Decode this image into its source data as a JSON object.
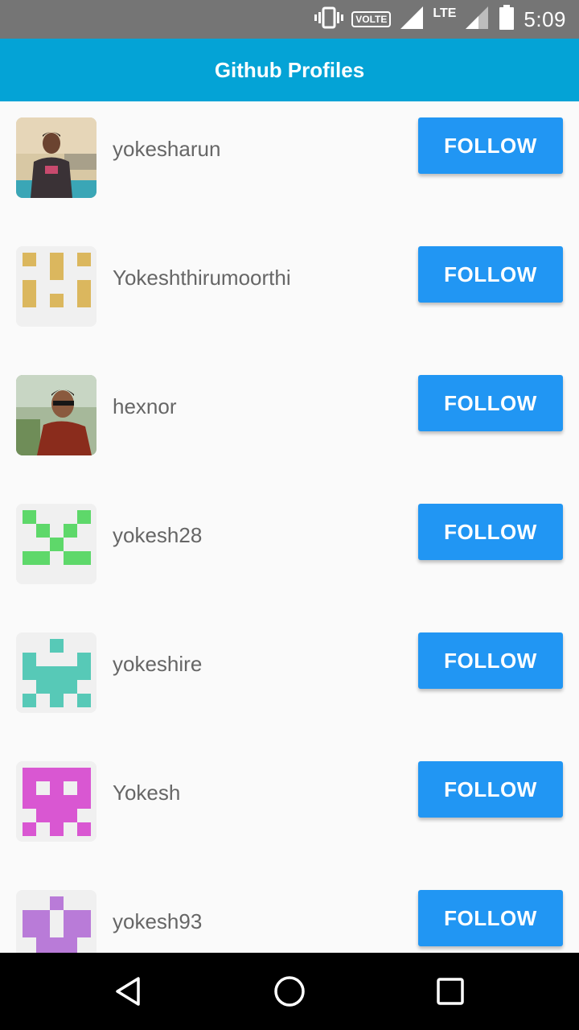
{
  "status_bar": {
    "time": "5:09",
    "volte": "VOLTE",
    "lte": "LTE"
  },
  "app_bar": {
    "title": "Github Profiles"
  },
  "profiles": [
    {
      "username": "yokesharun",
      "button": "FOLLOW",
      "avatar": "photo"
    },
    {
      "username": "Yokeshthirumoorthi",
      "button": "FOLLOW",
      "avatar": "identicon",
      "color": "#dbb75e"
    },
    {
      "username": "hexnor",
      "button": "FOLLOW",
      "avatar": "photo"
    },
    {
      "username": "yokesh28",
      "button": "FOLLOW",
      "avatar": "identicon",
      "color": "#5ed86a"
    },
    {
      "username": "yokeshire",
      "button": "FOLLOW",
      "avatar": "identicon",
      "color": "#57c9b7"
    },
    {
      "username": "Yokesh",
      "button": "FOLLOW",
      "avatar": "identicon",
      "color": "#d957d2"
    },
    {
      "username": "yokesh93",
      "button": "FOLLOW",
      "avatar": "identicon",
      "color": "#b97bd8"
    }
  ],
  "colors": {
    "app_bar": "#04a3d6",
    "button": "#2196f3",
    "status_bar": "#757575"
  }
}
